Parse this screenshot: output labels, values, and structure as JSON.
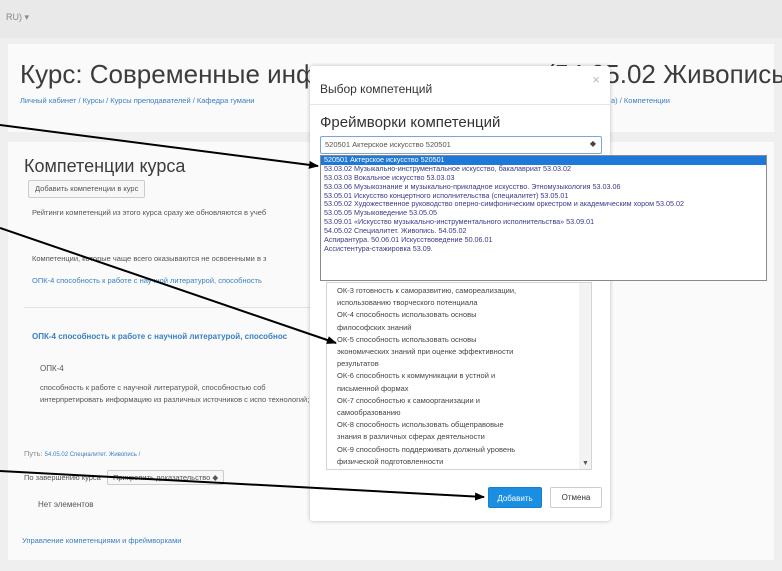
{
  "topbar": {
    "lang": "RU) ▾"
  },
  "course": {
    "title_left": "Курс: Современные информ",
    "title_right": "(54.05.02 Живопись)",
    "breadcrumb_left": "Личный кабинет / Курсы / Курсы преподавателей / Кафедра гумани",
    "breadcrumb_right": "а) / Компетенции"
  },
  "main": {
    "section_title": "Компетенции курса",
    "add_button": "Добавить компетенции в курс",
    "rating_note": "Рейтинги компетенций из этого курса сразу же обновляются в учеб",
    "often_note": "Компетенции, которые чаще всего оказываются не освоенными в з",
    "often_link": "ОПК-4 способность к работе с научной литературой, способность",
    "competency_heading": "ОПК-4 способность к работе с научной литературой, способнос",
    "competency_code": "ОПК-4",
    "competency_desc": "способность к работе с научной литературой, способностью соб интерпретировать информацию из различных источников с испо технологий;",
    "path_label": "Путь:",
    "path_value": "54.05.02 Специалитет. Живопись /",
    "evidence_label": "По завершению курса",
    "evidence_select": "Прикрепить доказательство ◆",
    "no_elements": "Нет элементов",
    "bottom_link": "Управление компетенциями и фреймворками"
  },
  "modal": {
    "title": "Выбор компетенций",
    "close": "×",
    "subtitle": "Фреймворки компетенций",
    "select_value": "520501 Актерское искусство 520501",
    "select_caret": "◆",
    "list": [
      "ОК-3 готовность к саморазвитию, самореализации,",
      "использованию творческого потенциала",
      "ОК-4 способность использовать основы",
      "философских знаний",
      "ОК-5 способность использовать основы",
      "экономических знаний при оценке эффективности",
      "результатов",
      "ОК-6 способность к коммуникации в устной и",
      "письменной формах",
      "ОК-7 способностью к самоорганизации и",
      "самообразованию",
      "ОК-8 способность использовать общеправовые",
      "знания в различных сферах деятельности",
      "ОК-9 способность поддерживать должный уровень",
      "физической подготовленности"
    ],
    "add_button": "Добавить",
    "cancel_button": "Отмена"
  },
  "dropdown": {
    "options": [
      "520501 Актерское искусство 520501",
      "53.03.02 Музыкально-инструментальное искусство, бакалавриат 53.03.02",
      "53.03.03 Вокальное искусство 53.03.03",
      "53.03.06 Музыкознание и музыкально-прикладное искусство. Этномузыкология 53.03.06",
      "53.05.01 Искусство концертного исполнительства (специалитет) 53.05.01",
      "53.05.02 Художественное руководство оперно-симфоническим оркестром и академическим хором 53.05.02",
      "53.05.05 Музыковедение 53.05.05",
      "53.09.01 «Искусство музыкально-инструментального исполнительства» 53.09.01",
      "54.05.02 Специалитет. Живопись. 54.05.02",
      "Аспирантура. 50.06.01 Искусствоведение 50.06.01",
      "Ассистентура-стажировка 53.09."
    ],
    "selected_index": 0
  }
}
